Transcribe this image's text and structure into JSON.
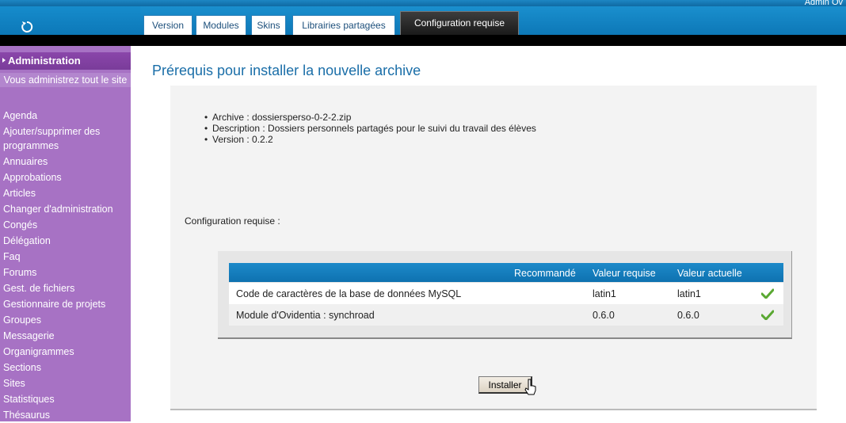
{
  "topbar": {
    "user_label": "Admin Ov",
    "tabs": [
      "Version",
      "Modules",
      "Skins",
      "Librairies partagées",
      "Configuration requise"
    ],
    "active_tab": "Configuration requise"
  },
  "sidebar": {
    "title": "Administration",
    "info": "Vous administrez tout le site",
    "items": [
      "Agenda",
      "Ajouter/supprimer des programmes",
      "Annuaires",
      "Approbations",
      "Articles",
      "Changer d'administration",
      "Congés",
      "Délégation",
      "Faq",
      "Forums",
      "Gest. de fichiers",
      "Gestionnaire de projets",
      "Groupes",
      "Messagerie",
      "Organigrammes",
      "Sections",
      "Sites",
      "Statistiques",
      "Thésaurus"
    ]
  },
  "main": {
    "title": "Prérequis pour installer la nouvelle archive",
    "info": [
      "Archive : dossiersperso-0-2-2.zip",
      "Description : Dossiers personnels partagés pour le suivi du travail des élèves",
      "Version : 0.2.2"
    ],
    "requirements_label": "Configuration requise :",
    "table": {
      "headers": [
        "",
        "Recommandé",
        "Valeur requise",
        "Valeur actuelle",
        ""
      ],
      "rows": [
        {
          "name": "Code de caractères de la base de données MySQL",
          "recommended": "",
          "required": "latin1",
          "current": "latin1",
          "ok": true
        },
        {
          "name": "Module d'Ovidentia : synchroad",
          "recommended": "",
          "required": "0.6.0",
          "current": "0.6.0",
          "ok": true
        }
      ]
    },
    "install_button": "Installer"
  },
  "colors": {
    "header_blue": "#1483c4",
    "sidebar_purple": "#a772c4",
    "title_blue": "#1a6ea8",
    "check_green": "#5aa832"
  }
}
